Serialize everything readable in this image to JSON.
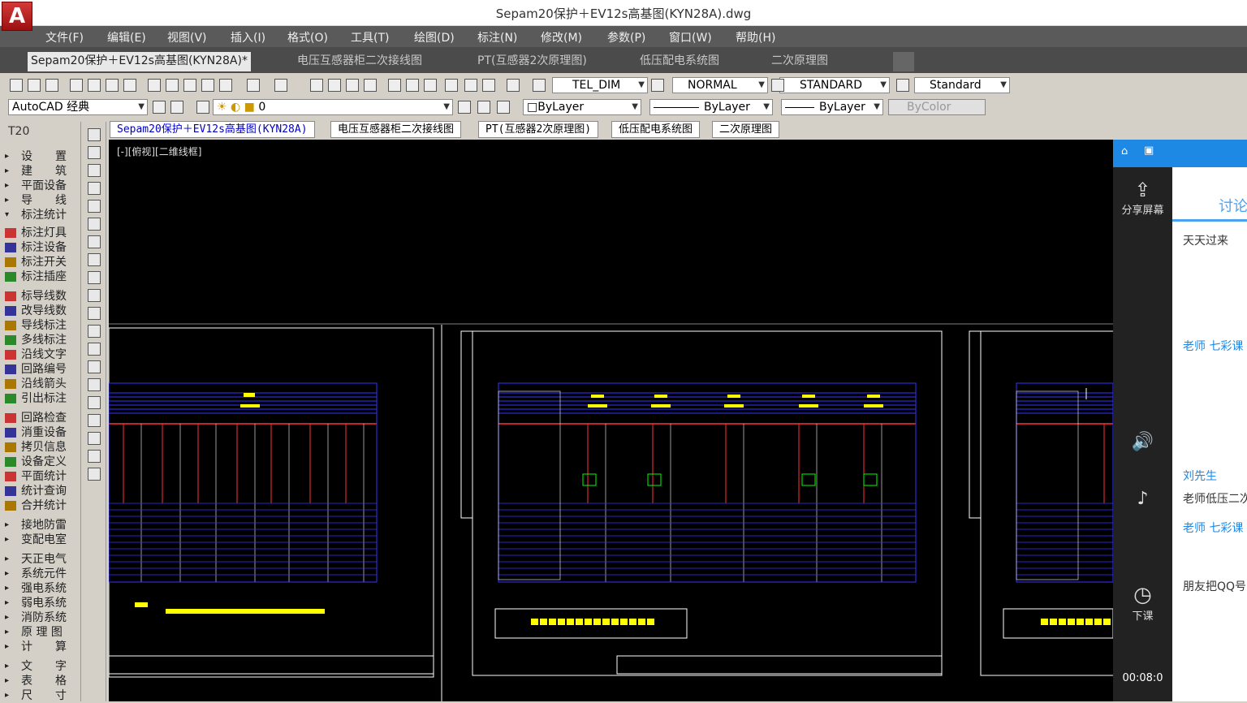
{
  "window": {
    "title": "Sepam20保护＋EV12s高基图(KYN28A).dwg",
    "logo": "A"
  },
  "menu": [
    "文件(F)",
    "编辑(E)",
    "视图(V)",
    "插入(I)",
    "格式(O)",
    "工具(T)",
    "绘图(D)",
    "标注(N)",
    "修改(M)",
    "参数(P)",
    "窗口(W)",
    "帮助(H)"
  ],
  "doc_tabs": [
    "Sepam20保护＋EV12s高基图(KYN28A)*",
    "电压互感器柜二次接线图",
    "PT(互感器2次原理图)",
    "低压配电系统图",
    "二次原理图"
  ],
  "toolbar": {
    "text_style": "TEL_DIM",
    "dim_style": "NORMAL",
    "table_style": "STANDARD",
    "mleader_style": "Standard"
  },
  "toolbar2": {
    "workspace": "AutoCAD 经典",
    "layer": "0",
    "color": "ByLayer",
    "linetype": "ByLayer",
    "lineweight": "ByLayer",
    "plotstyle": "ByColor"
  },
  "left_panel": {
    "header": "T20",
    "items": [
      "设　　置",
      "建　　筑",
      "平面设备",
      "导　　线",
      "标注统计",
      "标注灯具",
      "标注设备",
      "标注开关",
      "标注插座",
      "标导线数",
      "改导线数",
      "导线标注",
      "多线标注",
      "沿线文字",
      "回路编号",
      "沿线箭头",
      "引出标注",
      "回路检查",
      "消重设备",
      "拷贝信息",
      "设备定义",
      "平面统计",
      "统计查询",
      "合并统计",
      "接地防雷",
      "变配电室",
      "天正电气",
      "系统元件",
      "强电系统",
      "弱电系统",
      "消防系统",
      "原 理 图",
      "计　　算",
      "文　　字",
      "表　　格",
      "尺　　寸"
    ]
  },
  "drawing_tabs": [
    "Sepam20保护＋EV12s高基图(KYN28A)",
    "电压互感器柜二次接线图",
    "PT(互感器2次原理图)",
    "低压配电系统图",
    "二次原理图"
  ],
  "viewport_label": "[-][俯视][二维线框]",
  "right_panel": {
    "share_label": "分享屏幕",
    "end_label": "下课",
    "timer": "00:08:0",
    "discuss": "讨论",
    "messages": [
      "天天过来",
      "老师",
      "七彩课",
      "刘先生",
      "老师低压二次",
      "老师",
      "七彩课",
      "朋友把QQ号"
    ]
  },
  "colors": {
    "canvas": "#000000",
    "cyan": "#00ffff",
    "red": "#ff3333",
    "yellow": "#ffff00",
    "blue": "#3333ff",
    "white": "#ffffff",
    "green": "#00ff00"
  }
}
